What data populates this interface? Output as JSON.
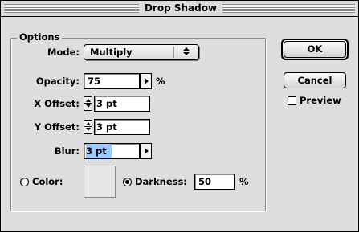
{
  "window": {
    "title": "Drop Shadow"
  },
  "options": {
    "group_title": "Options",
    "mode": {
      "label": "Mode:",
      "value": "Multiply"
    },
    "opacity": {
      "label": "Opacity:",
      "value": "75",
      "unit": "%"
    },
    "x_offset": {
      "label": "X Offset:",
      "value": "3 pt"
    },
    "y_offset": {
      "label": "Y Offset:",
      "value": "3 pt"
    },
    "blur": {
      "label": "Blur:",
      "value": "3 pt"
    },
    "color": {
      "label": "Color:",
      "selected": false
    },
    "darkness": {
      "label": "Darkness:",
      "value": "50",
      "unit": "%",
      "selected": true
    }
  },
  "buttons": {
    "ok": "OK",
    "cancel": "Cancel"
  },
  "preview": {
    "label": "Preview",
    "checked": false
  },
  "colors": {
    "dialog_bg": "#dddddd",
    "selection": "#9cc9ff"
  }
}
